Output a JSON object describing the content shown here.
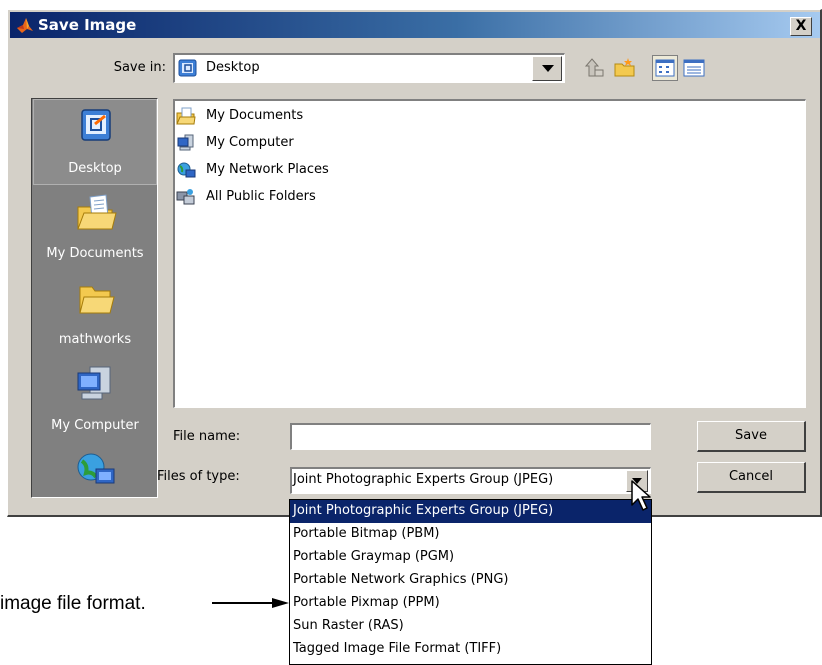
{
  "dialog": {
    "title": "Save Image",
    "close_label": "X"
  },
  "save_in": {
    "label": "Save in:",
    "value": "Desktop"
  },
  "toolbar": {
    "icons": [
      "up-one-level-icon",
      "create-new-folder-icon",
      "list-view-icon",
      "details-view-icon"
    ]
  },
  "places": [
    {
      "label": "Desktop",
      "icon": "desktop-icon",
      "selected": true
    },
    {
      "label": "My Documents",
      "icon": "my-documents-icon",
      "selected": false
    },
    {
      "label": "mathworks",
      "icon": "folder-icon",
      "selected": false
    },
    {
      "label": "My Computer",
      "icon": "my-computer-icon",
      "selected": false
    },
    {
      "label": "",
      "icon": "my-network-places-icon",
      "selected": false
    }
  ],
  "files": [
    {
      "name": "My Documents",
      "icon": "my-documents-icon"
    },
    {
      "name": "My Computer",
      "icon": "my-computer-icon"
    },
    {
      "name": "My Network Places",
      "icon": "my-network-places-icon"
    },
    {
      "name": "All Public Folders",
      "icon": "public-folders-icon"
    }
  ],
  "file_name": {
    "label": "File name:",
    "value": "",
    "placeholder": ""
  },
  "file_type": {
    "label": "Files of type:",
    "value": "Joint Photographic Experts Group (JPEG)",
    "options": [
      "Joint Photographic Experts Group (JPEG)",
      "Portable Bitmap (PBM)",
      "Portable Graymap (PGM)",
      "Portable Network Graphics (PNG)",
      "Portable Pixmap (PPM)",
      "Sun Raster (RAS)",
      "Tagged Image File Format (TIFF)"
    ],
    "selected_index": 0
  },
  "buttons": {
    "save": "Save",
    "cancel": "Cancel"
  },
  "annotation": {
    "text": "image file format."
  },
  "colors": {
    "title_bar": "#0a246a",
    "dialog_face": "#d4d0c8",
    "places_bg": "#808080",
    "selection": "#0a246a"
  }
}
